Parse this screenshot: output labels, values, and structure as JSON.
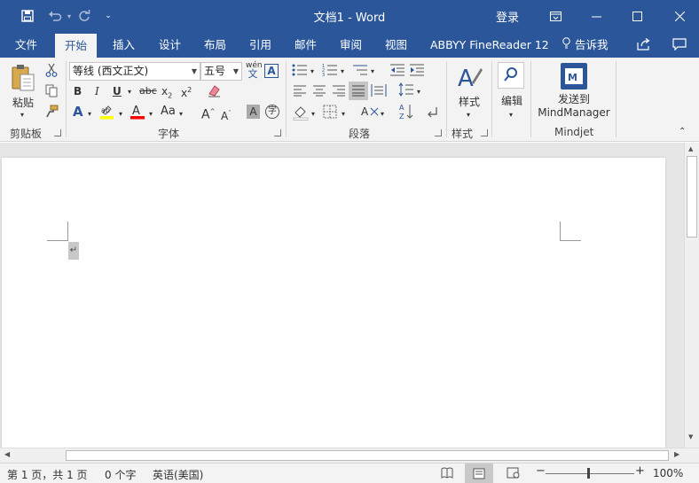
{
  "titlebar": {
    "title": "文档1 - Word",
    "signin": "登录",
    "icons": [
      "save-icon",
      "undo-icon",
      "redo-icon",
      "customize-qat-icon",
      "ribbon-display-icon",
      "minimize-icon",
      "maximize-icon",
      "close-icon"
    ]
  },
  "tabs": {
    "file": "文件",
    "home": "开始",
    "insert": "插入",
    "design": "设计",
    "layout": "布局",
    "references": "引用",
    "mailings": "邮件",
    "review": "审阅",
    "view": "视图",
    "abbyy": "ABBYY FineReader 12",
    "tellme": "告诉我"
  },
  "ribbon": {
    "clipboard": {
      "paste_label": "粘贴",
      "group_label": "剪贴板"
    },
    "font": {
      "font_name": "等线 (西文正文)",
      "font_size": "五号",
      "phonetic_top": "wén",
      "phonetic_bottom": "文",
      "group_label": "字体"
    },
    "paragraph": {
      "group_label": "段落"
    },
    "styles": {
      "styles_label": "样式",
      "group_label": "样式"
    },
    "editing": {
      "edit_label": "编辑"
    },
    "mindjet": {
      "send_label_1": "发送到",
      "send_label_2": "MindManager",
      "group_label": "Mindjet"
    }
  },
  "status": {
    "page": "第 1 页，共 1 页",
    "words": "0 个字",
    "language": "英语(美国)",
    "zoom": "100%"
  },
  "accent_color": "#2b579a"
}
